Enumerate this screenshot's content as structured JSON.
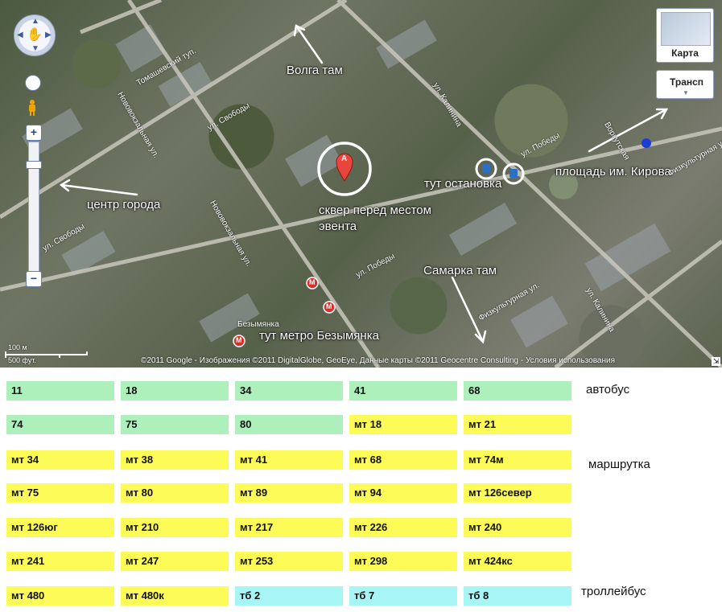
{
  "map": {
    "labels": [
      "Волга там",
      "центр города",
      "сквер перед местом эвента",
      "тут остановка",
      "площадь им. Кирова",
      "Самарка там",
      "тут метро Безымянка"
    ],
    "streets": {
      "tomashevsky": "Томашевский туп.",
      "svobody1": "ул. Свободы",
      "svobody2": "ул. Свободы",
      "novovokzalnaya1": "Нововокзальная ул.",
      "novovokzalnaya2": "Нововокзальная ул.",
      "pobedy1": "ул. Победы",
      "pobedy2": "ул. Победы",
      "kalinina1": "ул. Калинина",
      "kalinina2": "ул. Калинина",
      "fizkult1": "Физкультурная ул.",
      "fizkult2": "Физкультурная ул.",
      "vorkut": "Воркутская",
      "bezymyanka": "Безымянка"
    },
    "marker": "A",
    "map_type_label": "Карта",
    "traffic_label": "Трансп",
    "copyright": "©2011 Google - Изображения ©2011 DigitalGlobe, GeoEye, Данные карты ©2011 Geocentre Consulting - Условия использования",
    "scale": {
      "metric": "100 м",
      "imperial": "500 фут."
    },
    "metro_letter": "M"
  },
  "routes": {
    "rows": [
      [
        {
          "t": "11",
          "k": "bus"
        },
        {
          "t": "18",
          "k": "bus"
        },
        {
          "t": "34",
          "k": "bus"
        },
        {
          "t": "41",
          "k": "bus"
        },
        {
          "t": "68",
          "k": "bus"
        }
      ],
      [
        {
          "t": "74",
          "k": "bus"
        },
        {
          "t": "75",
          "k": "bus"
        },
        {
          "t": "80",
          "k": "bus"
        },
        {
          "t": "мт 18",
          "k": "mt"
        },
        {
          "t": "мт 21",
          "k": "mt"
        }
      ],
      [
        {
          "t": "мт 34",
          "k": "mt"
        },
        {
          "t": "мт 38",
          "k": "mt"
        },
        {
          "t": "мт 41",
          "k": "mt"
        },
        {
          "t": "мт 68",
          "k": "mt"
        },
        {
          "t": "мт 74м",
          "k": "mt"
        }
      ],
      [
        {
          "t": "мт 75",
          "k": "mt"
        },
        {
          "t": "мт 80",
          "k": "mt"
        },
        {
          "t": "мт 89",
          "k": "mt"
        },
        {
          "t": "мт 94",
          "k": "mt"
        },
        {
          "t": "мт 126север",
          "k": "mt"
        }
      ],
      [
        {
          "t": "мт 126юг",
          "k": "mt"
        },
        {
          "t": "мт 210",
          "k": "mt"
        },
        {
          "t": "мт 217",
          "k": "mt"
        },
        {
          "t": "мт 226",
          "k": "mt"
        },
        {
          "t": "мт 240",
          "k": "mt"
        }
      ],
      [
        {
          "t": "мт 241",
          "k": "mt"
        },
        {
          "t": "мт 247",
          "k": "mt"
        },
        {
          "t": "мт 253",
          "k": "mt"
        },
        {
          "t": "мт 298",
          "k": "mt"
        },
        {
          "t": "мт 424кс",
          "k": "mt"
        }
      ],
      [
        {
          "t": "мт 480",
          "k": "mt"
        },
        {
          "t": "мт 480к",
          "k": "mt"
        },
        {
          "t": "тб 2",
          "k": "tb"
        },
        {
          "t": "тб 7",
          "k": "tb"
        },
        {
          "t": "тб 8",
          "k": "tb"
        }
      ]
    ],
    "legend": {
      "bus": "автобус",
      "mt": "маршрутка",
      "tb": "троллейбус"
    }
  }
}
